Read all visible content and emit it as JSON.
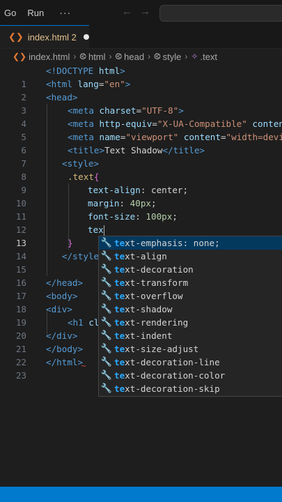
{
  "menu": {
    "go": "Go",
    "run": "Run",
    "more": "···"
  },
  "nav": {
    "back_icon": "arrow-left-icon",
    "forward_icon": "arrow-right-icon",
    "back": "←",
    "forward": "→"
  },
  "tab": {
    "label": "index.html 2",
    "icon": "❮❯"
  },
  "breadcrumb": {
    "file": "index.html",
    "items": [
      "html",
      "head",
      "style",
      ".text"
    ]
  },
  "editor": {
    "line_numbers": [
      "1",
      "2",
      "3",
      "4",
      "5",
      "6",
      "7",
      "8",
      "9",
      "10",
      "11",
      "12",
      "13",
      "14",
      "15",
      "16",
      "17",
      "18",
      "19",
      "20",
      "21",
      "22",
      "23"
    ],
    "active_line": 13
  },
  "code": {
    "l1": {
      "a": "<!DOCTYPE ",
      "b": "html",
      "c": ">"
    },
    "l2": {
      "a": "<html ",
      "b": "lang",
      "c": "=",
      "d": "\"en\"",
      "e": ">"
    },
    "l3": "<head>",
    "l4": {
      "a": "<meta ",
      "b": "charset",
      "c": "=",
      "d": "\"UTF-8\"",
      "e": ">"
    },
    "l5": {
      "a": "<meta ",
      "b": "http-equiv",
      "c": "=",
      "d": "\"X-UA-Compatible\"",
      "e": " ",
      "f": "content"
    },
    "l6": {
      "a": "<meta ",
      "b": "name",
      "c": "=",
      "d": "\"viewport\"",
      "e": " ",
      "f": "content",
      "g": "=",
      "h": "\"width=devi"
    },
    "l7": {
      "a": "<title>",
      "b": "Text Shadow",
      "c": "</title>"
    },
    "l8": "<style>",
    "l9": {
      "a": ".text",
      "b": "{"
    },
    "l10": {
      "a": "text-align",
      "b": ": center;"
    },
    "l11": {
      "a": "margin",
      "b": ": ",
      "c": "40px",
      "d": ";"
    },
    "l12": {
      "a": "font-size",
      "b": ": ",
      "c": "100px",
      "d": ";"
    },
    "l13": "tex",
    "l14": "}",
    "l15": "</style",
    "l17": "</head>",
    "l18": "<body>",
    "l19": "<div>",
    "l20": {
      "a": "<h1 ",
      "b": "cl"
    },
    "l21": "</div>",
    "l22": "</body>",
    "l23": "</html>",
    "squiggle": "~"
  },
  "suggest": {
    "icon": "wrench-icon",
    "icon_glyph": "🔧",
    "match": "te",
    "items": [
      {
        "match": "te",
        "rest": "xt-emphasis: none;"
      },
      {
        "match": "te",
        "rest": "xt-align"
      },
      {
        "match": "te",
        "rest": "xt-decoration"
      },
      {
        "match": "te",
        "rest": "xt-transform"
      },
      {
        "match": "te",
        "rest": "xt-overflow"
      },
      {
        "match": "te",
        "rest": "xt-shadow"
      },
      {
        "match": "te",
        "rest": "xt-rendering"
      },
      {
        "match": "te",
        "rest": "xt-indent"
      },
      {
        "match": "te",
        "rest": "xt-size-adjust"
      },
      {
        "match": "te",
        "rest": "xt-decoration-line"
      },
      {
        "match": "te",
        "rest": "xt-decoration-color"
      },
      {
        "match": "te",
        "rest": "xt-decoration-skip"
      }
    ]
  },
  "colors": {
    "accent": "#007acc",
    "selection": "#04395e",
    "match": "#2aaaff"
  }
}
